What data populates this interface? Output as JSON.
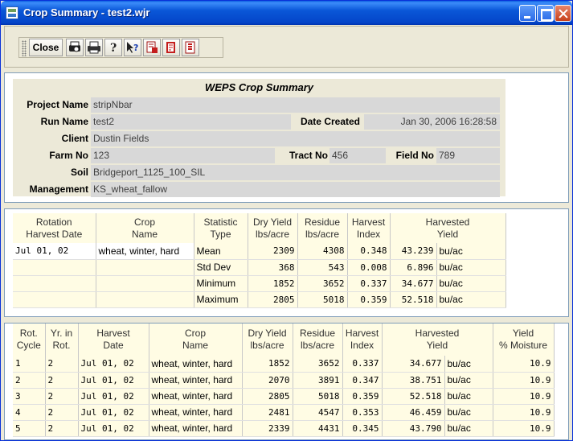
{
  "window": {
    "title": "Crop Summary - test2.wjr"
  },
  "toolbar": {
    "close_label": "Close",
    "icons": [
      "print-preview-icon",
      "print-icon",
      "help-icon",
      "context-help-icon",
      "report-icon",
      "report-red-icon",
      "report-export-icon"
    ]
  },
  "summary": {
    "title": "WEPS Crop Summary",
    "project_name_label": "Project Name",
    "project_name": "stripNbar",
    "run_name_label": "Run Name",
    "run_name": "test2",
    "date_created_label": "Date Created",
    "date_created": "Jan 30, 2006 16:28:58",
    "client_label": "Client",
    "client": "Dustin Fields",
    "farm_no_label": "Farm No",
    "farm_no": "123",
    "tract_no_label": "Tract No",
    "tract_no": "456",
    "field_no_label": "Field No",
    "field_no": "789",
    "soil_label": "Soil",
    "soil": "Bridgeport_1125_100_SIL",
    "management_label": "Management",
    "management": "KS_wheat_fallow"
  },
  "stats_table": {
    "headers": [
      [
        "Rotation",
        "Harvest Date"
      ],
      [
        "Crop",
        "Name"
      ],
      [
        "Statistic",
        "Type"
      ],
      [
        "Dry Yield",
        "lbs/acre"
      ],
      [
        "Residue",
        "lbs/acre"
      ],
      [
        "Harvest",
        "Index"
      ],
      [
        "Harvested",
        "Yield"
      ]
    ],
    "rows": [
      {
        "date": "Jul 01, 02",
        "crop": "wheat, winter, hard",
        "stat": "Mean",
        "dry": "2309",
        "residue": "4308",
        "index": "0.348",
        "yield": "43.239",
        "unit": "bu/ac"
      },
      {
        "date": "",
        "crop": "",
        "stat": "Std Dev",
        "dry": "368",
        "residue": "543",
        "index": "0.008",
        "yield": "6.896",
        "unit": "bu/ac"
      },
      {
        "date": "",
        "crop": "",
        "stat": "Minimum",
        "dry": "1852",
        "residue": "3652",
        "index": "0.337",
        "yield": "34.677",
        "unit": "bu/ac"
      },
      {
        "date": "",
        "crop": "",
        "stat": "Maximum",
        "dry": "2805",
        "residue": "5018",
        "index": "0.359",
        "yield": "52.518",
        "unit": "bu/ac"
      }
    ]
  },
  "detail_table": {
    "headers": [
      [
        "Rot.",
        "Cycle"
      ],
      [
        "Yr. in",
        "Rot."
      ],
      [
        "Harvest",
        "Date"
      ],
      [
        "Crop",
        "Name"
      ],
      [
        "Dry Yield",
        "lbs/acre"
      ],
      [
        "Residue",
        "lbs/acre"
      ],
      [
        "Harvest",
        "Index"
      ],
      [
        "Harvested",
        "Yield"
      ],
      [
        "Yield",
        "% Moisture"
      ]
    ],
    "rows": [
      {
        "cycle": "1",
        "yr": "2",
        "date": "Jul 01, 02",
        "crop": "wheat, winter, hard",
        "dry": "1852",
        "residue": "3652",
        "index": "0.337",
        "yield": "34.677",
        "unit": "bu/ac",
        "moisture": "10.9"
      },
      {
        "cycle": "2",
        "yr": "2",
        "date": "Jul 01, 02",
        "crop": "wheat, winter, hard",
        "dry": "2070",
        "residue": "3891",
        "index": "0.347",
        "yield": "38.751",
        "unit": "bu/ac",
        "moisture": "10.9"
      },
      {
        "cycle": "3",
        "yr": "2",
        "date": "Jul 01, 02",
        "crop": "wheat, winter, hard",
        "dry": "2805",
        "residue": "5018",
        "index": "0.359",
        "yield": "52.518",
        "unit": "bu/ac",
        "moisture": "10.9"
      },
      {
        "cycle": "4",
        "yr": "2",
        "date": "Jul 01, 02",
        "crop": "wheat, winter, hard",
        "dry": "2481",
        "residue": "4547",
        "index": "0.353",
        "yield": "46.459",
        "unit": "bu/ac",
        "moisture": "10.9"
      },
      {
        "cycle": "5",
        "yr": "2",
        "date": "Jul 01, 02",
        "crop": "wheat, winter, hard",
        "dry": "2339",
        "residue": "4431",
        "index": "0.345",
        "yield": "43.790",
        "unit": "bu/ac",
        "moisture": "10.9"
      }
    ]
  }
}
